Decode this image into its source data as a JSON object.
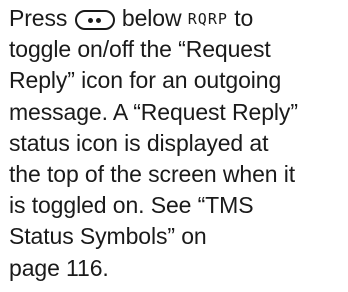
{
  "paragraph": {
    "line1_before": "Press ",
    "line1_middle": " below ",
    "softkey_label": "RQRP",
    "line1_after": " to",
    "line2": "toggle on/off the “Request",
    "line3": "Reply” icon for an outgoing",
    "line4": "message. A “Request Reply”",
    "line5": "status icon is displayed at",
    "line6": "the top of the screen when it",
    "line7": "is toggled on. See “TMS",
    "line8": "Status Symbols” on",
    "line9": "page 116."
  },
  "icons": {
    "button_icon": "oval-button-dots-icon"
  },
  "colors": {
    "text": "#1a1a1a",
    "background": "#ffffff"
  }
}
